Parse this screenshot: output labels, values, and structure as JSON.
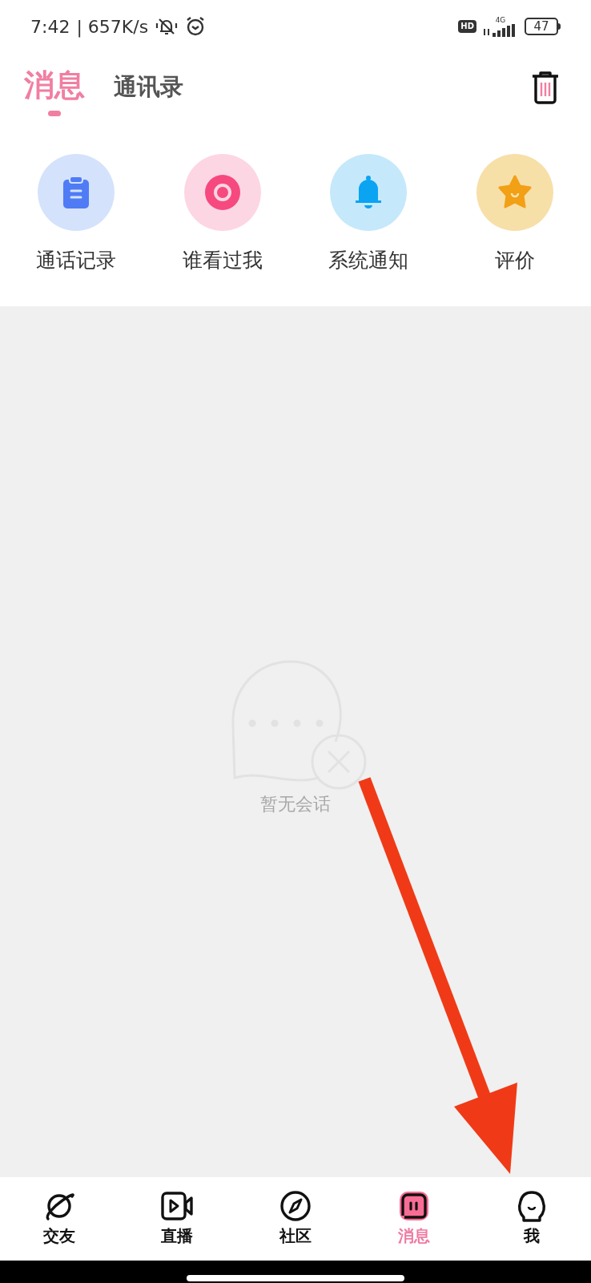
{
  "status_bar": {
    "time": "7:42",
    "speed": "| 657K/s",
    "hd": "HD",
    "network": "4G",
    "battery": "47"
  },
  "tabs": [
    {
      "label": "消息",
      "selected": true
    },
    {
      "label": "通讯录",
      "selected": false
    }
  ],
  "shortcuts": [
    {
      "label": "通话记录",
      "kind": "clipboard"
    },
    {
      "label": "谁看过我",
      "kind": "eye"
    },
    {
      "label": "系统通知",
      "kind": "bell"
    },
    {
      "label": "评价",
      "kind": "star"
    }
  ],
  "empty_state": {
    "text": "暂无会话"
  },
  "bottom_nav": [
    {
      "label": "交友",
      "kind": "planet",
      "selected": false
    },
    {
      "label": "直播",
      "kind": "video",
      "selected": false
    },
    {
      "label": "社区",
      "kind": "compass",
      "selected": false
    },
    {
      "label": "消息",
      "kind": "message",
      "selected": true
    },
    {
      "label": "我",
      "kind": "person",
      "selected": false
    }
  ]
}
